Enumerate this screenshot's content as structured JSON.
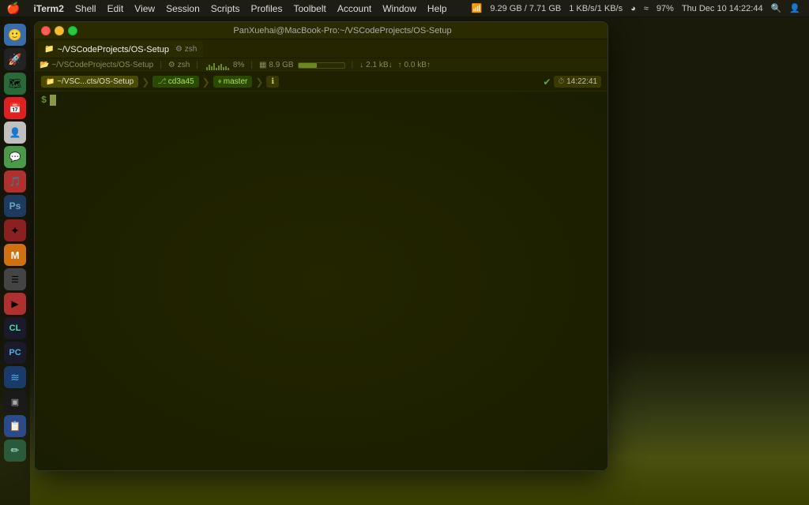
{
  "menubar": {
    "apple": "🍎",
    "app_name": "iTerm2",
    "items": [
      "Shell",
      "Edit",
      "View",
      "Session",
      "Scripts",
      "Profiles",
      "Toolbelt",
      "Account",
      "Window",
      "Help"
    ],
    "right": {
      "network_up": "1 KB/s",
      "network_down": "1 KB/s",
      "disk": "9.29 GB / 7.71 GB",
      "bluetooth": "BT",
      "wifi": "WiFi",
      "battery": "97%",
      "datetime": "Thu Dec 10  14:22:44"
    }
  },
  "iterm": {
    "title": "PanXuehai@MacBook-Pro:~/VSCodeProjects/OS-Setup",
    "tab": {
      "label": "~/VSCodeProjects/OS-Setup",
      "shell": "zsh"
    },
    "statusbar_top": {
      "cpu_label": "8%",
      "memory": "8.9 GB",
      "network_down": "2.1 kB↓",
      "network_up": "0.0 kB↑"
    },
    "prompt": {
      "path": "~/VSC...cts/OS-Setup",
      "arrow": "",
      "git_icon": "",
      "branch": "cd3a45",
      "git_status": "master",
      "info_icon": "ℹ",
      "checkmark": "✔",
      "time": "14:22:41",
      "clock": "⏱"
    },
    "terminal": {
      "dollar": "$"
    }
  },
  "dock": {
    "icons": [
      {
        "name": "finder",
        "emoji": "😊",
        "color": "#4a8af4"
      },
      {
        "name": "launchpad",
        "emoji": "🚀",
        "color": "#888"
      },
      {
        "name": "maps",
        "emoji": "🗺",
        "color": "#4a8"
      },
      {
        "name": "calendar",
        "emoji": "📅",
        "color": "#f44"
      },
      {
        "name": "contacts",
        "emoji": "👤",
        "color": "#888"
      },
      {
        "name": "wechat",
        "emoji": "💬",
        "color": "#4a8"
      },
      {
        "name": "netease-music",
        "emoji": "🎵",
        "color": "#c44"
      },
      {
        "name": "photoshop",
        "emoji": "Ps",
        "color": "#1e3a5f"
      },
      {
        "name": "app8",
        "emoji": "✦",
        "color": "#c84"
      },
      {
        "name": "matlab",
        "emoji": "M",
        "color": "#e84"
      },
      {
        "name": "app10",
        "emoji": "☰",
        "color": "#444"
      },
      {
        "name": "app11",
        "emoji": "▶",
        "color": "#c44"
      },
      {
        "name": "clion",
        "emoji": "C",
        "color": "#3a8"
      },
      {
        "name": "pycharm",
        "emoji": "P",
        "color": "#3a8"
      },
      {
        "name": "vscode",
        "emoji": "≋",
        "color": "#4a9"
      },
      {
        "name": "terminal-app",
        "emoji": "▣",
        "color": "#333"
      },
      {
        "name": "app17",
        "emoji": "📋",
        "color": "#4af"
      },
      {
        "name": "app18",
        "emoji": "✏",
        "color": "#3a6"
      }
    ]
  }
}
